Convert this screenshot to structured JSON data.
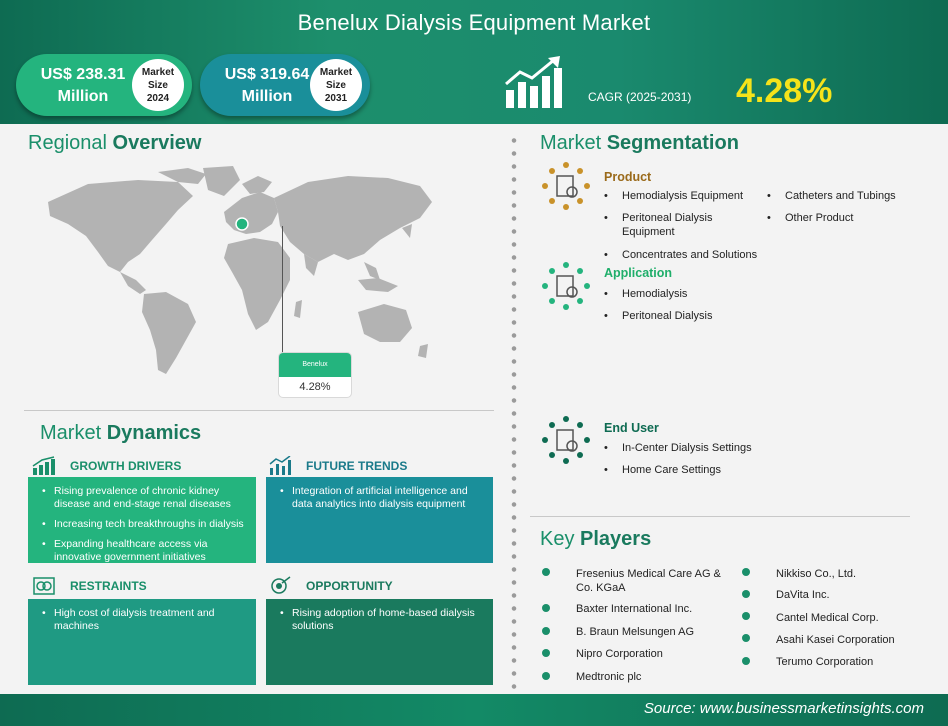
{
  "header": {
    "title": "Benelux Dialysis Equipment Market",
    "stat_2024": {
      "value_line1": "US$ 238.31",
      "value_line2": "Million",
      "label_line1": "Market",
      "label_line2": "Size",
      "label_line3": "2024"
    },
    "stat_2031": {
      "value_line1": "US$ 319.64",
      "value_line2": "Million",
      "label_line1": "Market",
      "label_line2": "Size",
      "label_line3": "2031"
    },
    "cagr_label": "CAGR (2025-2031)",
    "cagr_value": "4.28%",
    "cagr_icon": "growth-chart-icon"
  },
  "regional": {
    "title_light": "Regional ",
    "title_bold": "Overview",
    "map_label": "Benelux",
    "map_value": "4.28%"
  },
  "dynamics": {
    "title_light": "Market ",
    "title_bold": "Dynamics",
    "growth_drivers": {
      "label": "GROWTH DRIVERS",
      "items": [
        "Rising  prevalence of chronic kidney disease and end-stage renal diseases",
        "Increasing tech breakthroughs in dialysis",
        "Expanding healthcare access via innovative government initiatives"
      ]
    },
    "future_trends": {
      "label": "FUTURE TRENDS",
      "items": [
        "Integration of artificial intelligence and data analytics into dialysis equipment"
      ]
    },
    "restraints": {
      "label": "RESTRAINTS",
      "items": [
        "High cost of dialysis treatment and machines"
      ]
    },
    "opportunity": {
      "label": "OPPORTUNITY",
      "items": [
        "Rising adoption of home-based dialysis solutions"
      ]
    }
  },
  "segmentation": {
    "title_light": "Market ",
    "title_bold": "Segmentation",
    "product": {
      "label": "Product",
      "items": [
        "Hemodialysis Equipment",
        "Peritoneal Dialysis Equipment",
        "Concentrates and Solutions",
        "Catheters and Tubings",
        "Other Product"
      ]
    },
    "application": {
      "label": "Application",
      "items": [
        "Hemodialysis",
        "Peritoneal Dialysis"
      ]
    },
    "end_user": {
      "label": "End User",
      "items": [
        "In-Center Dialysis Settings",
        "Home Care Settings"
      ]
    }
  },
  "key_players": {
    "title_light": "Key ",
    "title_bold": "Players",
    "left": [
      "Fresenius Medical Care AG & Co. KGaA",
      "Baxter International Inc.",
      "B. Braun Melsungen AG",
      "Nipro Corporation",
      "Medtronic plc"
    ],
    "right": [
      "Nikkiso Co., Ltd.",
      "DaVita Inc.",
      "Cantel Medical Corp.",
      "Asahi Kasei Corporation",
      "Terumo Corporation"
    ]
  },
  "footer": {
    "source": "Source: www.businessmarketinsights.com"
  },
  "colors": {
    "brand_green": "#1a8f6a",
    "accent_yellow": "#f5e31a",
    "teal": "#1a8f9a",
    "light_green": "#24b47e"
  }
}
